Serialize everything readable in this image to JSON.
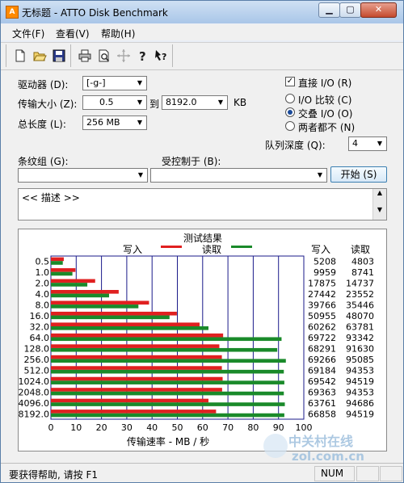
{
  "window": {
    "title": "无标题 - ATTO Disk Benchmark",
    "icon_text": "A",
    "minimize": "▁",
    "maximize": "▢",
    "close": "✕"
  },
  "menu": {
    "items": [
      {
        "label": "文件(F)"
      },
      {
        "label": "查看(V)"
      },
      {
        "label": "帮助(H)"
      }
    ]
  },
  "toolbar": {
    "icons": [
      "new-file-icon",
      "open-folder-icon",
      "save-icon",
      "print-icon",
      "print-preview-icon",
      "move-icon",
      "help-icon",
      "context-help-icon"
    ]
  },
  "settings": {
    "drive_label": "驱动器 (D):",
    "drive_value": "[-g-]",
    "transfer_label": "传输大小 (Z):",
    "transfer_from": "0.5",
    "transfer_to_label": "到",
    "transfer_to": "8192.0",
    "transfer_unit": "KB",
    "length_label": "总长度 (L):",
    "length_value": "256 MB",
    "direct_io_label": "直接 I/O (R)",
    "direct_io_checked": true,
    "io_compare_label": "I/O 比较 (C)",
    "io_overlap_label": "交叠 I/O (O)",
    "io_neither_label": "两者都不 (N)",
    "queue_label": "队列深度 (Q):",
    "queue_value": "4",
    "stripe_label": "条纹组 (G):",
    "controlled_label": "受控制于 (B):",
    "start_button": "开始 (S)",
    "description": "<< 描述 >>"
  },
  "chart_data": {
    "type": "bar",
    "title": "测试结果",
    "xlabel": "传输速率 - MB / 秒",
    "ylabel": "",
    "xlim": [
      0,
      100
    ],
    "xticks": [
      "0",
      "10",
      "20",
      "30",
      "40",
      "50",
      "60",
      "70",
      "80",
      "90",
      "100"
    ],
    "categories": [
      "0.5",
      "1.0",
      "2.0",
      "4.0",
      "8.0",
      "16.0",
      "32.0",
      "64.0",
      "128.0",
      "256.0",
      "512.0",
      "1024.0",
      "2048.0",
      "4096.0",
      "8192.0"
    ],
    "series": [
      {
        "name": "写入",
        "color": "#e02020",
        "values": [
          5.1,
          9.7,
          17.5,
          26.8,
          38.8,
          49.8,
          58.8,
          68.1,
          66.6,
          67.6,
          67.6,
          67.9,
          67.7,
          62.3,
          65.3
        ]
      },
      {
        "name": "读取",
        "color": "#1a8a2a",
        "values": [
          4.7,
          8.5,
          14.4,
          23.0,
          34.6,
          46.9,
          62.3,
          91.2,
          89.5,
          92.9,
          92.1,
          92.3,
          92.1,
          92.5,
          92.3
        ]
      }
    ],
    "table_headers": [
      "写入",
      "读取"
    ],
    "table_rows": [
      [
        "5208",
        "4803"
      ],
      [
        "9959",
        "8741"
      ],
      [
        "17875",
        "14737"
      ],
      [
        "27442",
        "23552"
      ],
      [
        "39766",
        "35446"
      ],
      [
        "50955",
        "48070"
      ],
      [
        "60262",
        "63781"
      ],
      [
        "69722",
        "93342"
      ],
      [
        "68291",
        "91630"
      ],
      [
        "69266",
        "95085"
      ],
      [
        "69184",
        "94353"
      ],
      [
        "69542",
        "94519"
      ],
      [
        "69363",
        "94353"
      ],
      [
        "63761",
        "94686"
      ],
      [
        "66858",
        "94519"
      ]
    ],
    "grid": true,
    "legend": "top"
  },
  "status": {
    "text": "要获得帮助, 请按 F1",
    "num": "NUM"
  },
  "watermark": {
    "text": "中关村在线",
    "domain": "zol.com.cn"
  },
  "colors": {
    "write": "#e02020",
    "read": "#1a8a2a",
    "grid": "#1a1a8a"
  }
}
